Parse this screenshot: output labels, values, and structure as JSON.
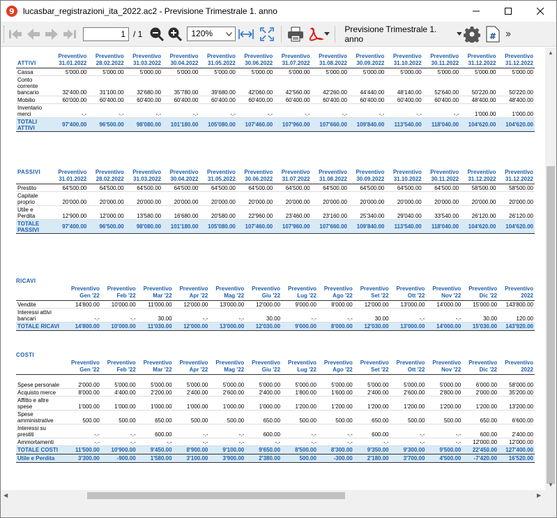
{
  "window": {
    "title": "lucasbar_registrazioni_ita_2022.ac2 - Previsione Trimestrale 1. anno",
    "app_icon_glyph": "9"
  },
  "toolbar": {
    "page_value": "1",
    "page_total": "/ 1",
    "zoom": "120%",
    "view_name": "Previsione Trimestrale 1. anno"
  },
  "attivi": {
    "title": "ATTIVI",
    "headers": [
      [
        "Preventivo",
        "31.01.2022"
      ],
      [
        "Preventivo",
        "28.02.2022"
      ],
      [
        "Preventivo",
        "31.03.2022"
      ],
      [
        "Preventivo",
        "30.04.2022"
      ],
      [
        "Preventivo",
        "31.05.2022"
      ],
      [
        "Preventivo",
        "30.06.2022"
      ],
      [
        "Preventivo",
        "31.07.2022"
      ],
      [
        "Preventivo",
        "31.08.2022"
      ],
      [
        "Preventivo",
        "30.09.2022"
      ],
      [
        "Preventivo",
        "31.10.2022"
      ],
      [
        "Preventivo",
        "30.11.2022"
      ],
      [
        "Preventivo",
        "31.12.2022"
      ],
      [
        "Preventivo",
        "31.12.2022"
      ]
    ],
    "rows": [
      {
        "label": "Cassa",
        "values": [
          "5'000.00",
          "5'000.00",
          "5'000.00",
          "5'000.00",
          "5'000.00",
          "5'000.00",
          "5'000.00",
          "5'000.00",
          "5'000.00",
          "5'000.00",
          "5'000.00",
          "5'000.00",
          "5'000.00"
        ]
      },
      {
        "label": "Conto corrente bancario",
        "values": [
          "32'400.00",
          "31'100.00",
          "32'680.00",
          "35'780.00",
          "39'680.00",
          "42'060.00",
          "42'560.00",
          "42'260.00",
          "44'440.00",
          "48'140.00",
          "52'640.00",
          "50'220.00",
          "50'220.00"
        ]
      },
      {
        "label": "Mobilio",
        "values": [
          "60'000.00",
          "60'400.00",
          "60'400.00",
          "60'400.00",
          "60'400.00",
          "60'400.00",
          "60'400.00",
          "60'400.00",
          "60'400.00",
          "60'400.00",
          "60'400.00",
          "48'400.00",
          "48'400.00"
        ]
      },
      {
        "label": "Inventario merci",
        "values": [
          "-.-",
          "-.-",
          "-.-",
          "-.-",
          "-.-",
          "-.-",
          "-.-",
          "-.-",
          "-.-",
          "-.-",
          "-.-",
          "1'000.00",
          "1'000.00"
        ]
      }
    ],
    "total": {
      "label": "TOTALI ATTIVI",
      "values": [
        "97'400.00",
        "96'500.00",
        "98'080.00",
        "101'180.00",
        "105'080.00",
        "107'460.00",
        "107'960.00",
        "107'660.00",
        "109'840.00",
        "113'540.00",
        "118'040.00",
        "104'620.00",
        "104'620.00"
      ]
    }
  },
  "passivi": {
    "title": "PASSIVI",
    "headers": [
      [
        "Preventivo",
        "31.01.2022"
      ],
      [
        "Preventivo",
        "28.02.2022"
      ],
      [
        "Preventivo",
        "31.03.2022"
      ],
      [
        "Preventivo",
        "30.04.2022"
      ],
      [
        "Preventivo",
        "31.05.2022"
      ],
      [
        "Preventivo",
        "30.06.2022"
      ],
      [
        "Preventivo",
        "31.07.2022"
      ],
      [
        "Preventivo",
        "31.08.2022"
      ],
      [
        "Preventivo",
        "30.09.2022"
      ],
      [
        "Preventivo",
        "31.10.2022"
      ],
      [
        "Preventivo",
        "30.11.2022"
      ],
      [
        "Preventivo",
        "31.12.2022"
      ],
      [
        "Preventivo",
        "31.12.2022"
      ]
    ],
    "rows": [
      {
        "label": "Prestito",
        "values": [
          "64'500.00",
          "64'500.00",
          "64'500.00",
          "64'500.00",
          "64'500.00",
          "64'500.00",
          "64'500.00",
          "64'500.00",
          "64'500.00",
          "64'500.00",
          "64'500.00",
          "58'500.00",
          "58'500.00"
        ]
      },
      {
        "label": "Capitale proprio",
        "values": [
          "20'000.00",
          "20'000.00",
          "20'000.00",
          "20'000.00",
          "20'000.00",
          "20'000.00",
          "20'000.00",
          "20'000.00",
          "20'000.00",
          "20'000.00",
          "20'000.00",
          "20'000.00",
          "20'000.00"
        ]
      },
      {
        "label": "Utile e Perdita",
        "values": [
          "12'900.00",
          "12'000.00",
          "13'580.00",
          "16'680.00",
          "20'580.00",
          "22'960.00",
          "23'460.00",
          "23'160.00",
          "25'340.00",
          "29'040.00",
          "33'540.00",
          "26'120.00",
          "26'120.00"
        ]
      }
    ],
    "total": {
      "label": "TOTALE PASSIVI",
      "values": [
        "97'400.00",
        "96'500.00",
        "98'080.00",
        "101'180.00",
        "105'080.00",
        "107'460.00",
        "107'960.00",
        "107'660.00",
        "109'840.00",
        "113'540.00",
        "118'040.00",
        "104'620.00",
        "104'620.00"
      ]
    }
  },
  "ricavi": {
    "title": "RICAVI",
    "headers": [
      [
        "Preventivo",
        "Gen '22"
      ],
      [
        "Preventivo",
        "Feb '22"
      ],
      [
        "Preventivo",
        "Mar '22"
      ],
      [
        "Preventivo",
        "Apr '22"
      ],
      [
        "Preventivo",
        "Mag '22"
      ],
      [
        "Preventivo",
        "Giu '22"
      ],
      [
        "Preventivo",
        "Lug '22"
      ],
      [
        "Preventivo",
        "Ago '22"
      ],
      [
        "Preventivo",
        "Set '22"
      ],
      [
        "Preventivo",
        "Ott '22"
      ],
      [
        "Preventivo",
        "Nov '22"
      ],
      [
        "Preventivo",
        "Dic '22"
      ],
      [
        "Preventivo",
        "2022"
      ]
    ],
    "rows": [
      {
        "label": "Vendite",
        "values": [
          "14'800.00",
          "10'000.00",
          "11'000.00",
          "12'000.00",
          "13'000.00",
          "12'000.00",
          "9'000.00",
          "8'000.00",
          "12'000.00",
          "13'000.00",
          "14'000.00",
          "15'000.00",
          "143'800.00"
        ]
      },
      {
        "label": "Interessi attivi bancari",
        "values": [
          "-.-",
          "-.-",
          "30.00",
          "-.-",
          "-.-",
          "30.00",
          "-.-",
          "-.-",
          "30.00",
          "-.-",
          "-.-",
          "30.00",
          "120.00"
        ]
      }
    ],
    "total": {
      "label": "TOTALE RICAVI",
      "values": [
        "14'800.00",
        "10'000.00",
        "11'030.00",
        "12'000.00",
        "13'000.00",
        "12'030.00",
        "9'000.00",
        "8'000.00",
        "12'030.00",
        "13'000.00",
        "14'000.00",
        "15'030.00",
        "143'920.00"
      ]
    }
  },
  "costi": {
    "title": "COSTI",
    "headers": [
      [
        "Preventivo",
        "Gen '22"
      ],
      [
        "Preventivo",
        "Feb '22"
      ],
      [
        "Preventivo",
        "Mar '22"
      ],
      [
        "Preventivo",
        "Apr '22"
      ],
      [
        "Preventivo",
        "Mag '22"
      ],
      [
        "Preventivo",
        "Giu '22"
      ],
      [
        "Preventivo",
        "Lug '22"
      ],
      [
        "Preventivo",
        "Ago '22"
      ],
      [
        "Preventivo",
        "Set '22"
      ],
      [
        "Preventivo",
        "Ott '22"
      ],
      [
        "Preventivo",
        "Nov '22"
      ],
      [
        "Preventivo",
        "Dic '22"
      ],
      [
        "Preventivo",
        "2022"
      ]
    ],
    "rows": [
      {
        "label": "Spese personale",
        "values": [
          "2'000.00",
          "5'000.00",
          "5'000.00",
          "5'000.00",
          "5'000.00",
          "5'000.00",
          "5'000.00",
          "5'000.00",
          "5'000.00",
          "5'000.00",
          "5'000.00",
          "6'000.00",
          "58'000.00"
        ]
      },
      {
        "label": "Acquisto merce",
        "values": [
          "8'000.00",
          "4'400.00",
          "2'200.00",
          "2'400.00",
          "2'600.00",
          "2'400.00",
          "1'800.00",
          "1'600.00",
          "2'400.00",
          "2'600.00",
          "2'800.00",
          "2'000.00",
          "35'200.00"
        ]
      },
      {
        "label": "Affitto e altre spese",
        "values": [
          "1'000.00",
          "1'000.00",
          "1'000.00",
          "1'000.00",
          "1'000.00",
          "1'000.00",
          "1'200.00",
          "1'200.00",
          "1'200.00",
          "1'200.00",
          "1'200.00",
          "1'200.00",
          "13'200.00"
        ]
      },
      {
        "label": "Spese amministrative",
        "values": [
          "500.00",
          "500.00",
          "650.00",
          "500.00",
          "500.00",
          "650.00",
          "500.00",
          "500.00",
          "650.00",
          "500.00",
          "500.00",
          "650.00",
          "6'600.00"
        ]
      },
      {
        "label": "Interessi su prestiti",
        "values": [
          "-.-",
          "-.-",
          "600.00",
          "-.-",
          "-.-",
          "600.00",
          "-.-",
          "-.-",
          "600.00",
          "-.-",
          "-.-",
          "600.00",
          "2'400.00"
        ]
      },
      {
        "label": "Ammortamenti",
        "values": [
          "-.-",
          "-.-",
          "-.-",
          "-.-",
          "-.-",
          "-.-",
          "-.-",
          "-.-",
          "-.-",
          "-.-",
          "-.-",
          "12'000.00",
          "12'000.00"
        ]
      }
    ],
    "total": {
      "label": "TOTALE COSTI",
      "values": [
        "11'500.00",
        "10'900.00",
        "9'450.00",
        "8'900.00",
        "9'100.00",
        "9'650.00",
        "8'500.00",
        "8'300.00",
        "9'350.00",
        "9'300.00",
        "9'500.00",
        "22'450.00",
        "127'400.00"
      ]
    },
    "result": {
      "label": "Utile e Perdita",
      "values": [
        "3'300.00",
        "-900.00",
        "1'580.00",
        "3'100.00",
        "3'900.00",
        "2'380.00",
        "500.00",
        "-300.00",
        "2'180.00",
        "3'700.00",
        "4'500.00",
        "-7'420.00",
        "16'520.00"
      ]
    }
  }
}
